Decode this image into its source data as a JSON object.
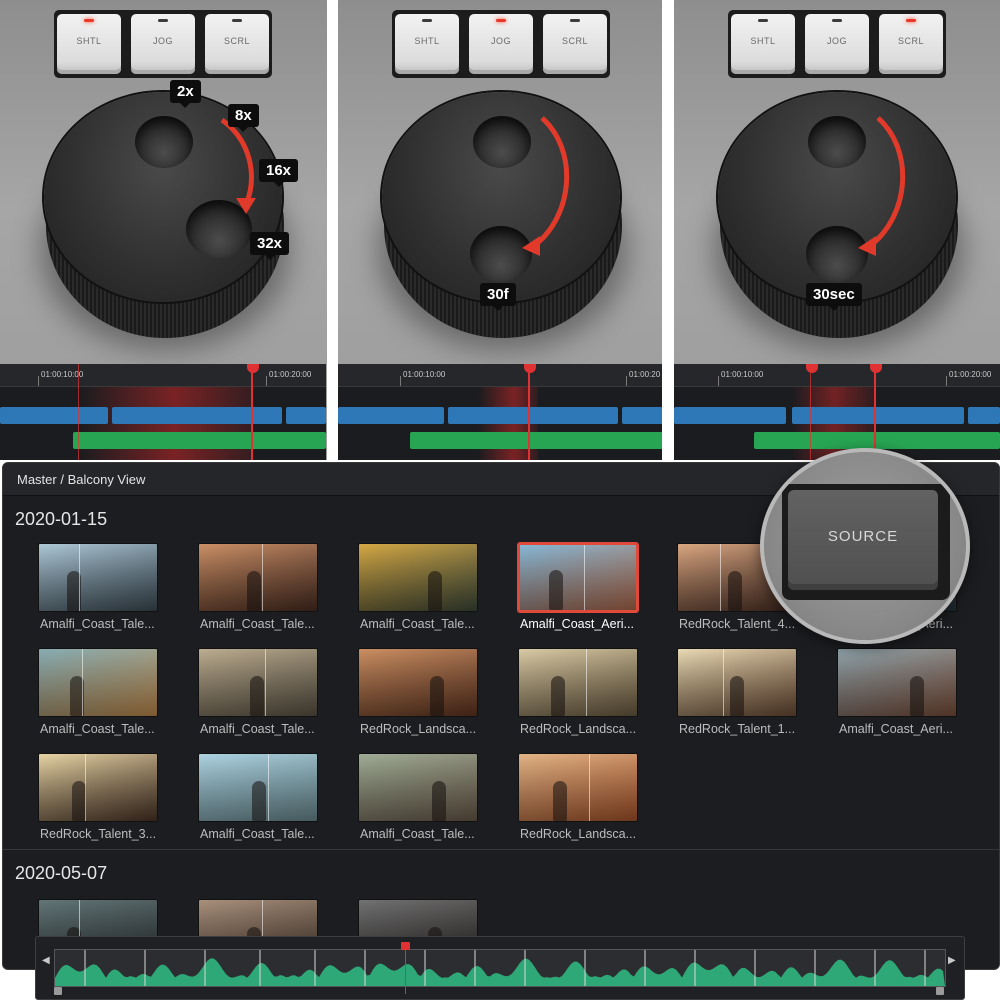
{
  "controls": {
    "keys": [
      "SHTL",
      "JOG",
      "SCRL"
    ]
  },
  "panels": [
    {
      "mode": "SHTL",
      "tags": [
        "2x",
        "8x",
        "16x",
        "32x"
      ],
      "timecodes": [
        "01:00:10:00",
        "01:00:20:00"
      ]
    },
    {
      "mode": "JOG",
      "tags": [
        "30f"
      ],
      "timecodes": [
        "01:00:10:00",
        "01:00:20"
      ]
    },
    {
      "mode": "SCRL",
      "tags": [
        "30sec"
      ],
      "timecodes": [
        "01:00:10:00",
        "01:00:20:00"
      ]
    }
  ],
  "browser": {
    "breadcrumb": "Master / Balcony View",
    "groups": [
      {
        "date": "2020-01-15",
        "clips": [
          {
            "name": "Amalfi_Coast_Tale...",
            "selected": false,
            "colors": [
              "#a9c6d6",
              "#3d4b55"
            ]
          },
          {
            "name": "Amalfi_Coast_Tale...",
            "selected": false,
            "colors": [
              "#c98a5e",
              "#4a2d22"
            ]
          },
          {
            "name": "Amalfi_Coast_Tale...",
            "selected": false,
            "colors": [
              "#d4a43a",
              "#3e4a3a"
            ]
          },
          {
            "name": "Amalfi_Coast_Aeri...",
            "selected": true,
            "colors": [
              "#7fb3d4",
              "#b06a4a"
            ]
          },
          {
            "name": "RedRock_Talent_4...",
            "selected": false,
            "colors": [
              "#d8a27a",
              "#4a2e24"
            ]
          },
          {
            "name": "Amalfi_Coast_Aeri...",
            "selected": false,
            "colors": [
              "#5f8aa6",
              "#2e3a46"
            ]
          },
          {
            "name": "Amalfi_Coast_Tale...",
            "selected": false,
            "colors": [
              "#7fa8b0",
              "#c08a4a"
            ]
          },
          {
            "name": "Amalfi_Coast_Tale...",
            "selected": false,
            "colors": [
              "#b9a98a",
              "#5a5244"
            ]
          },
          {
            "name": "RedRock_Landsca...",
            "selected": false,
            "colors": [
              "#c9895a",
              "#5e3420"
            ]
          },
          {
            "name": "RedRock_Landsca...",
            "selected": false,
            "colors": [
              "#d8c8a0",
              "#6a5a40"
            ]
          },
          {
            "name": "RedRock_Talent_1...",
            "selected": false,
            "colors": [
              "#e8d8b0",
              "#6a4a34"
            ]
          },
          {
            "name": "Amalfi_Coast_Aeri...",
            "selected": false,
            "colors": [
              "#8aa0a8",
              "#7a4e3a"
            ]
          },
          {
            "name": "RedRock_Talent_3...",
            "selected": false,
            "colors": [
              "#e6d2a0",
              "#4a3426"
            ]
          },
          {
            "name": "Amalfi_Coast_Tale...",
            "selected": false,
            "colors": [
              "#a8d0e0",
              "#6a8a90"
            ]
          },
          {
            "name": "Amalfi_Coast_Tale...",
            "selected": false,
            "colors": [
              "#9aa890",
              "#6a5a4a"
            ]
          },
          {
            "name": "RedRock_Landsca...",
            "selected": false,
            "colors": [
              "#e0b080",
              "#a8542a"
            ]
          }
        ]
      },
      {
        "date": "2020-05-07",
        "clips": [
          {
            "name": "",
            "selected": false,
            "colors": [
              "#5a6e70",
              "#2a3032"
            ]
          },
          {
            "name": "",
            "selected": false,
            "colors": [
              "#a48a74",
              "#4a3a30"
            ]
          },
          {
            "name": "",
            "selected": false,
            "colors": [
              "#6a6a6a",
              "#2a2624"
            ]
          }
        ]
      }
    ]
  },
  "zoom": {
    "key_label": "SOURCE"
  },
  "colors": {
    "accent_red": "#e03232",
    "clip_blue": "#2e78b8",
    "clip_green": "#27a552",
    "waveform": "#2fa878"
  },
  "icons": {
    "left_handle": "triangle-left-icon",
    "right_handle": "triangle-right-icon"
  }
}
